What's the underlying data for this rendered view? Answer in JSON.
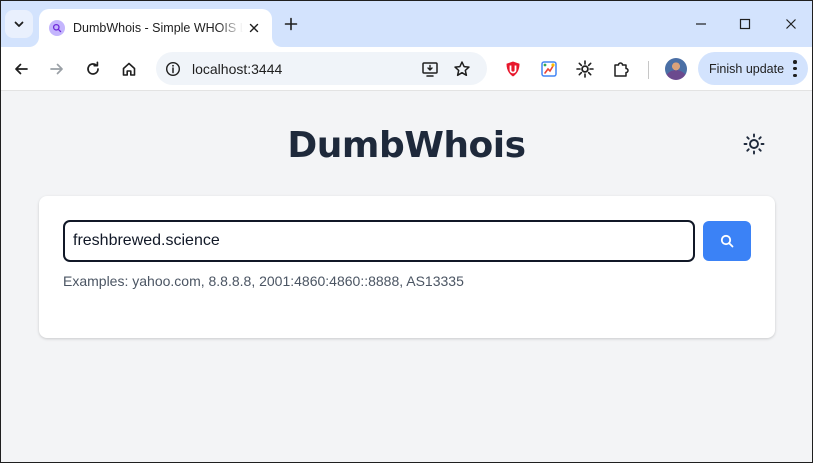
{
  "browser": {
    "tab": {
      "title": "DumbWhois - Simple WHOIS Lookup",
      "favicon": "search-favicon"
    },
    "address_bar": {
      "url": "localhost:3444"
    },
    "update_button": {
      "label": "Finish update"
    },
    "icons": {
      "tab_search": "chevron-down-icon",
      "new_tab": "plus-icon",
      "minimize": "minimize-icon",
      "maximize": "maximize-icon",
      "close": "close-icon",
      "back": "arrow-left-icon",
      "forward": "arrow-right-icon",
      "reload": "reload-icon",
      "home": "home-icon",
      "site_info": "tune-icon",
      "install": "install-app-icon",
      "bookmark": "star-icon",
      "extensions": [
        "ublock-icon",
        "color-picker-icon",
        "sunburst-icon",
        "puzzle-icon"
      ]
    }
  },
  "page": {
    "title": "DumbWhois",
    "theme_toggle_icon": "sun-icon",
    "search": {
      "value": "freshbrewed.science",
      "button_icon": "search-icon"
    },
    "examples_text": "Examples: yahoo.com, 8.8.8.8, 2001:4860:4860::8888, AS13335"
  },
  "colors": {
    "tabstrip": "#d3e3fd",
    "page_background": "#f3f4f6",
    "card": "#ffffff",
    "accent": "#3b82f6",
    "title_text": "#1e293b",
    "muted_text": "#4b5563"
  }
}
